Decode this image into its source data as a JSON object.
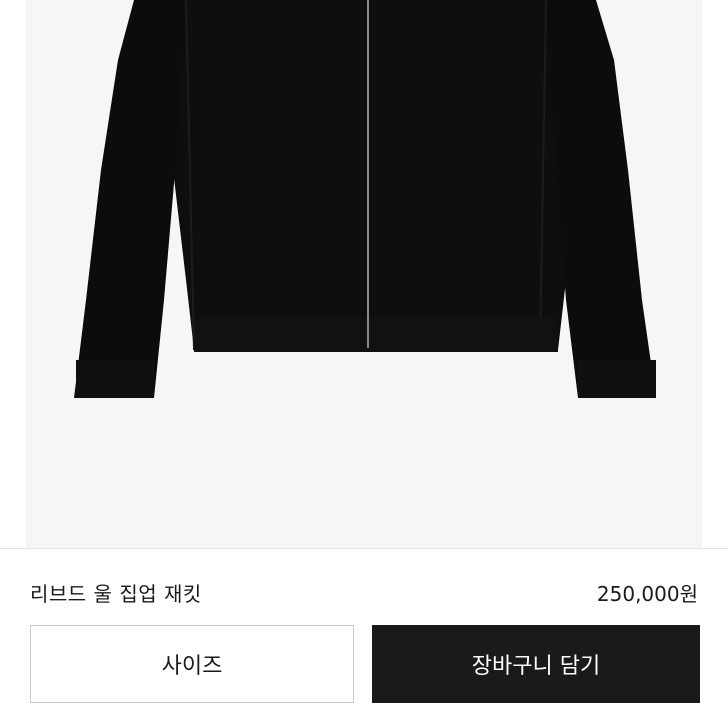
{
  "product": {
    "name": "리브드 울 집업 재킷",
    "price": "250,000원",
    "image_subject": "black-zip-up-jacket"
  },
  "actions": {
    "size_label": "사이즈",
    "cart_label": "장바구니 담기"
  },
  "colors": {
    "image_background": "#f6f6f7",
    "jacket": "#0e0e0e",
    "cart_button_bg": "#1a1a1a",
    "cart_button_text": "#ffffff",
    "size_button_border": "#c9c9c9"
  }
}
